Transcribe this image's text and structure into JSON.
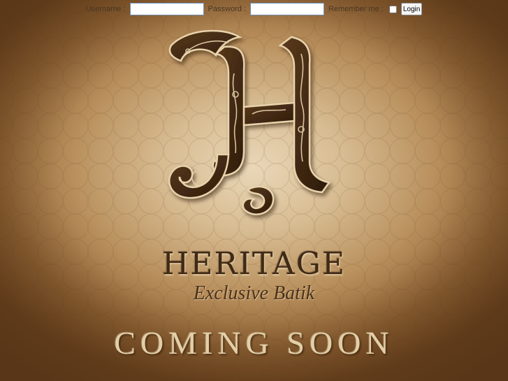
{
  "login": {
    "username_label": "Username :",
    "username_value": "",
    "password_label": "Password :",
    "password_value": "",
    "remember_label": "Remember me :",
    "remember_checked": false,
    "login_button": "Login"
  },
  "brand": {
    "monogram_letter": "H",
    "name": "HERITAGE",
    "tagline": "Exclusive Batik"
  },
  "status": {
    "message": "COMING SOON"
  },
  "colors": {
    "background": "#c6a677",
    "brand_dark": "#3f2a16",
    "coming_soon": "#e2cfa8",
    "input_border": "#6f8fb4"
  }
}
